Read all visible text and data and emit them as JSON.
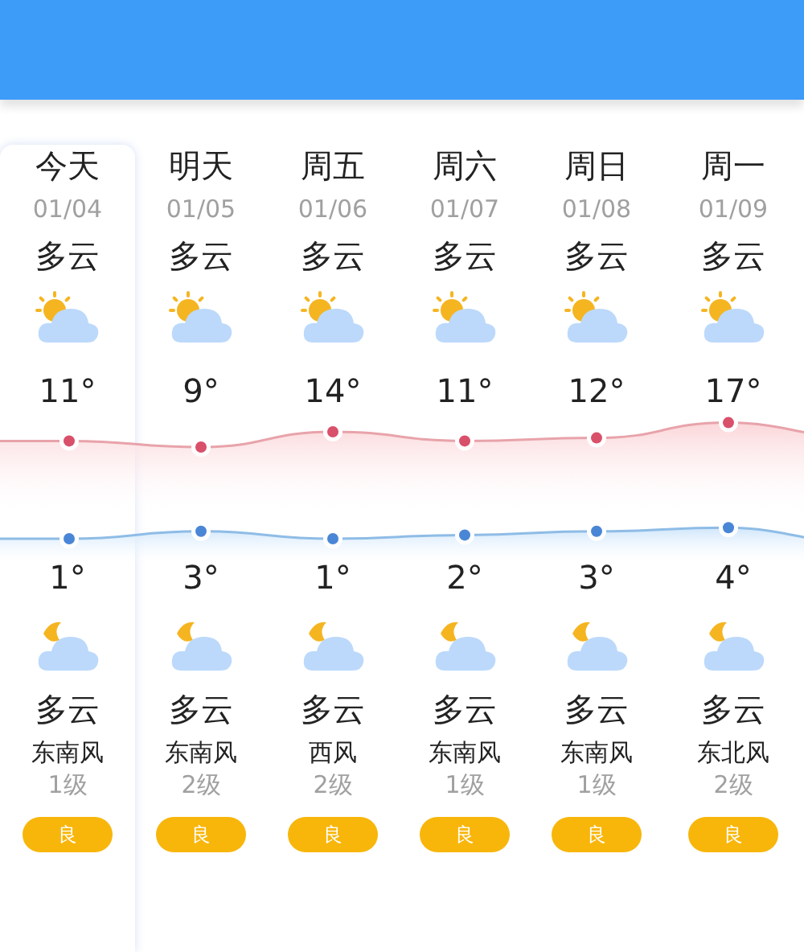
{
  "days": [
    {
      "name": "今天",
      "date": "01/04",
      "day_condition": "多云",
      "high": "11°",
      "low": "1°",
      "night_condition": "多云",
      "wind": "东南风",
      "wind_level": "1级",
      "aqi": "良",
      "selected": true
    },
    {
      "name": "明天",
      "date": "01/05",
      "day_condition": "多云",
      "high": "9°",
      "low": "3°",
      "night_condition": "多云",
      "wind": "东南风",
      "wind_level": "2级",
      "aqi": "良",
      "selected": false
    },
    {
      "name": "周五",
      "date": "01/06",
      "day_condition": "多云",
      "high": "14°",
      "low": "1°",
      "night_condition": "多云",
      "wind": "西风",
      "wind_level": "2级",
      "aqi": "良",
      "selected": false
    },
    {
      "name": "周六",
      "date": "01/07",
      "day_condition": "多云",
      "high": "11°",
      "low": "2°",
      "night_condition": "多云",
      "wind": "东南风",
      "wind_level": "1级",
      "aqi": "良",
      "selected": false
    },
    {
      "name": "周日",
      "date": "01/08",
      "day_condition": "多云",
      "high": "12°",
      "low": "3°",
      "night_condition": "多云",
      "wind": "东南风",
      "wind_level": "1级",
      "aqi": "良",
      "selected": false
    },
    {
      "name": "周一",
      "date": "01/09",
      "day_condition": "多云",
      "high": "17°",
      "low": "4°",
      "night_condition": "多云",
      "wind": "东北风",
      "wind_level": "2级",
      "aqi": "良",
      "selected": false
    }
  ]
}
